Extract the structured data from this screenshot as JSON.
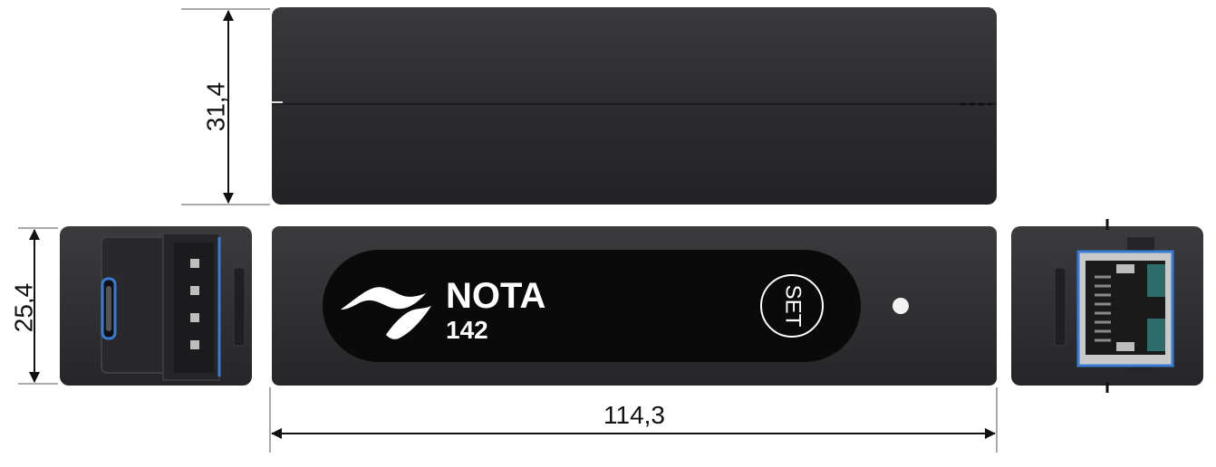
{
  "dimensions": {
    "height_top": "31,4",
    "height_side": "25,4",
    "length": "114,3"
  },
  "device": {
    "brand": "NOTA",
    "model": "142",
    "button_label": "SET"
  },
  "colors": {
    "body": "#2e2e30",
    "label_panel": "#0a0a0a",
    "accent_blue": "#3a7bd5",
    "arrow": "#111111"
  }
}
